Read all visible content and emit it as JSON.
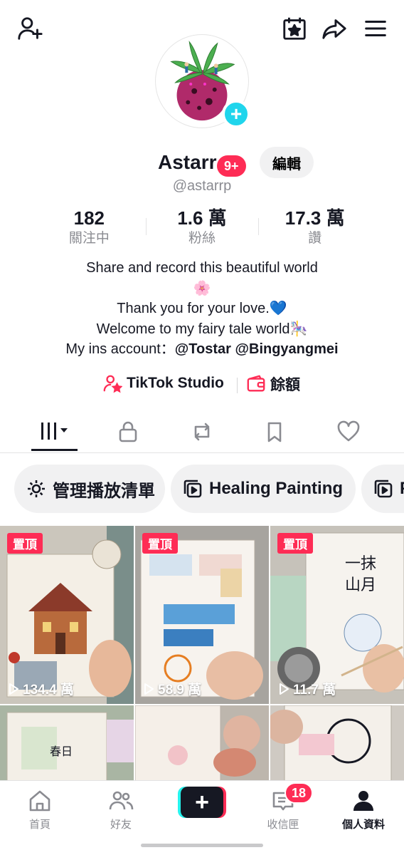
{
  "header": {
    "add_friend_icon": "person-plus-icon",
    "calendar_icon": "calendar-star-icon",
    "share_icon": "share-arrow-icon",
    "menu_icon": "hamburger-menu-icon"
  },
  "profile": {
    "display_name": "Astarr",
    "notification_badge": "9+",
    "edit_label": "編輯",
    "handle": "@astarrp",
    "avatar_icon": "avatar-image"
  },
  "stats": [
    {
      "value": "182",
      "label": "關注中"
    },
    {
      "value": "1.6 萬",
      "label": "粉絲"
    },
    {
      "value": "17.3 萬",
      "label": "讚"
    }
  ],
  "bio": {
    "line1": "Share and record this beautiful world",
    "line2": "🌸",
    "line3": "Thank you for your love.💙",
    "line4": "Welcome to my fairy tale world🎠",
    "line5_prefix": "My ins account：",
    "line5_handles": "@Tostar @Bingyangmei"
  },
  "links": {
    "studio_label": "TikTok Studio",
    "wallet_label": "餘額"
  },
  "tabs": [
    {
      "icon": "videos-grid-icon"
    },
    {
      "icon": "lock-icon"
    },
    {
      "icon": "repost-icon"
    },
    {
      "icon": "bookmark-icon"
    },
    {
      "icon": "heart-icon"
    }
  ],
  "playlists": [
    {
      "label": "管理播放清單",
      "icon": "gear-icon"
    },
    {
      "label": "Healing Painting",
      "icon": "playlist-icon"
    },
    {
      "label": "P",
      "icon": "playlist-icon"
    }
  ],
  "videos": [
    {
      "pinned": "置頂",
      "views": "134.4 萬"
    },
    {
      "pinned": "置頂",
      "views": "58.9 萬"
    },
    {
      "pinned": "置頂",
      "views": "11.7 萬"
    },
    {
      "pinned": "",
      "views": ""
    },
    {
      "pinned": "",
      "views": ""
    },
    {
      "pinned": "",
      "views": ""
    }
  ],
  "nav": {
    "home": "首頁",
    "friends": "好友",
    "inbox": "收信匣",
    "inbox_badge": "18",
    "profile": "個人資料"
  },
  "colors": {
    "accent_red": "#fe2c55",
    "accent_cyan": "#20d5ec",
    "text_primary": "#161823",
    "text_secondary": "#8a8b91"
  }
}
